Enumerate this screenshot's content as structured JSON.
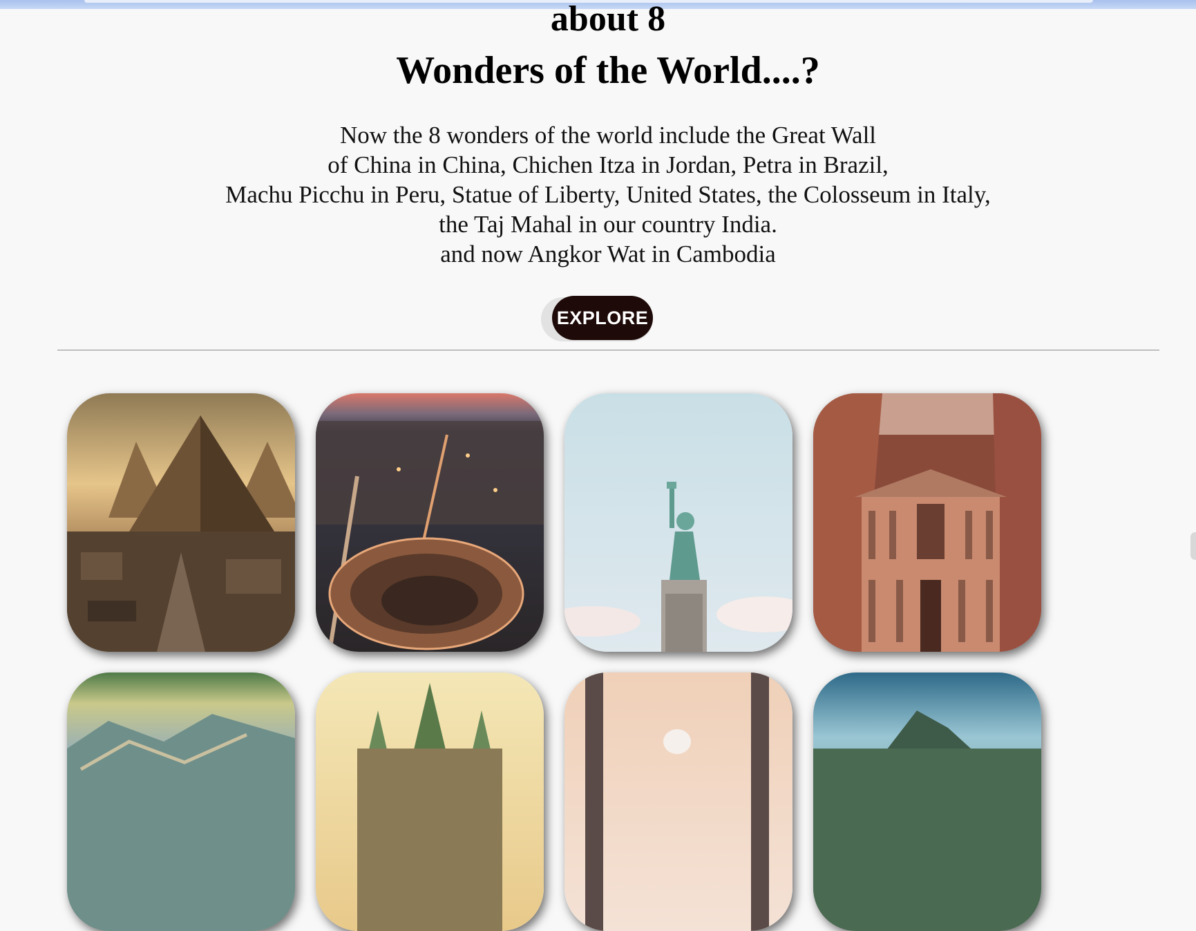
{
  "heading": {
    "line1": "about 8",
    "line2": "Wonders of the World....?"
  },
  "description": {
    "lines": [
      "Now the 8 wonders of the world include the Great Wall",
      "of China in China, Chichen Itza in Jordan, Petra in Brazil,",
      "Machu Picchu in Peru, Statue of Liberty, United States, the Colosseum in Italy,",
      "the Taj Mahal in our country India.",
      "and now Angkor Wat in Cambodia"
    ]
  },
  "explore_button": {
    "label": "EXPLORE"
  },
  "colors": {
    "page_background": "#f8f8f8",
    "button_background": "#1e0a08",
    "button_text": "#ffffff",
    "divider": "#8c8c8c"
  },
  "gallery": {
    "images": [
      {
        "subject": "Pyramids of Giza"
      },
      {
        "subject": "Colosseum"
      },
      {
        "subject": "Statue of Liberty"
      },
      {
        "subject": "Petra"
      },
      {
        "subject": "Great Wall of China"
      },
      {
        "subject": "Angkor Wat"
      },
      {
        "subject": "Taj Mahal"
      },
      {
        "subject": "Machu Picchu"
      }
    ]
  }
}
